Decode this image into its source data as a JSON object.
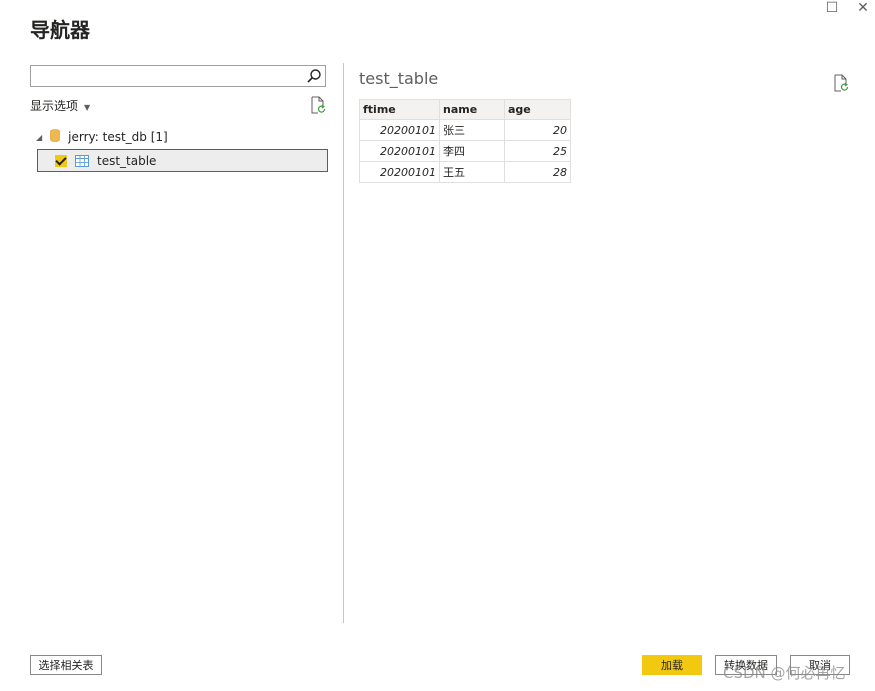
{
  "window": {
    "title": "导航器",
    "maximize_glyph": "☐",
    "close_glyph": "✕"
  },
  "left_pane": {
    "search": {
      "value": "",
      "placeholder": ""
    },
    "display_options_label": "显示选项",
    "tree": {
      "database": {
        "label": "jerry: test_db [1]",
        "expanded": true
      },
      "tables": [
        {
          "label": "test_table",
          "checked": true,
          "selected": true
        }
      ]
    }
  },
  "preview": {
    "title": "test_table",
    "columns": [
      "ftime",
      "name",
      "age"
    ],
    "rows": [
      [
        "20200101",
        "张三",
        "20"
      ],
      [
        "20200101",
        "李四",
        "25"
      ],
      [
        "20200101",
        "王五",
        "28"
      ]
    ]
  },
  "footer": {
    "select_related_label": "选择相关表",
    "load_label": "加载",
    "transform_label": "转换数据",
    "cancel_label": "取消"
  },
  "watermark": "CSDN @何必再忆",
  "colors": {
    "accent_yellow": "#f2c811",
    "border_gray": "#a19f9d",
    "selected_row_bg": "#ededed"
  },
  "icons": [
    "search-icon",
    "refresh-icon",
    "database-icon",
    "table-icon",
    "expand-triangle-icon",
    "checkbox-icon"
  ]
}
